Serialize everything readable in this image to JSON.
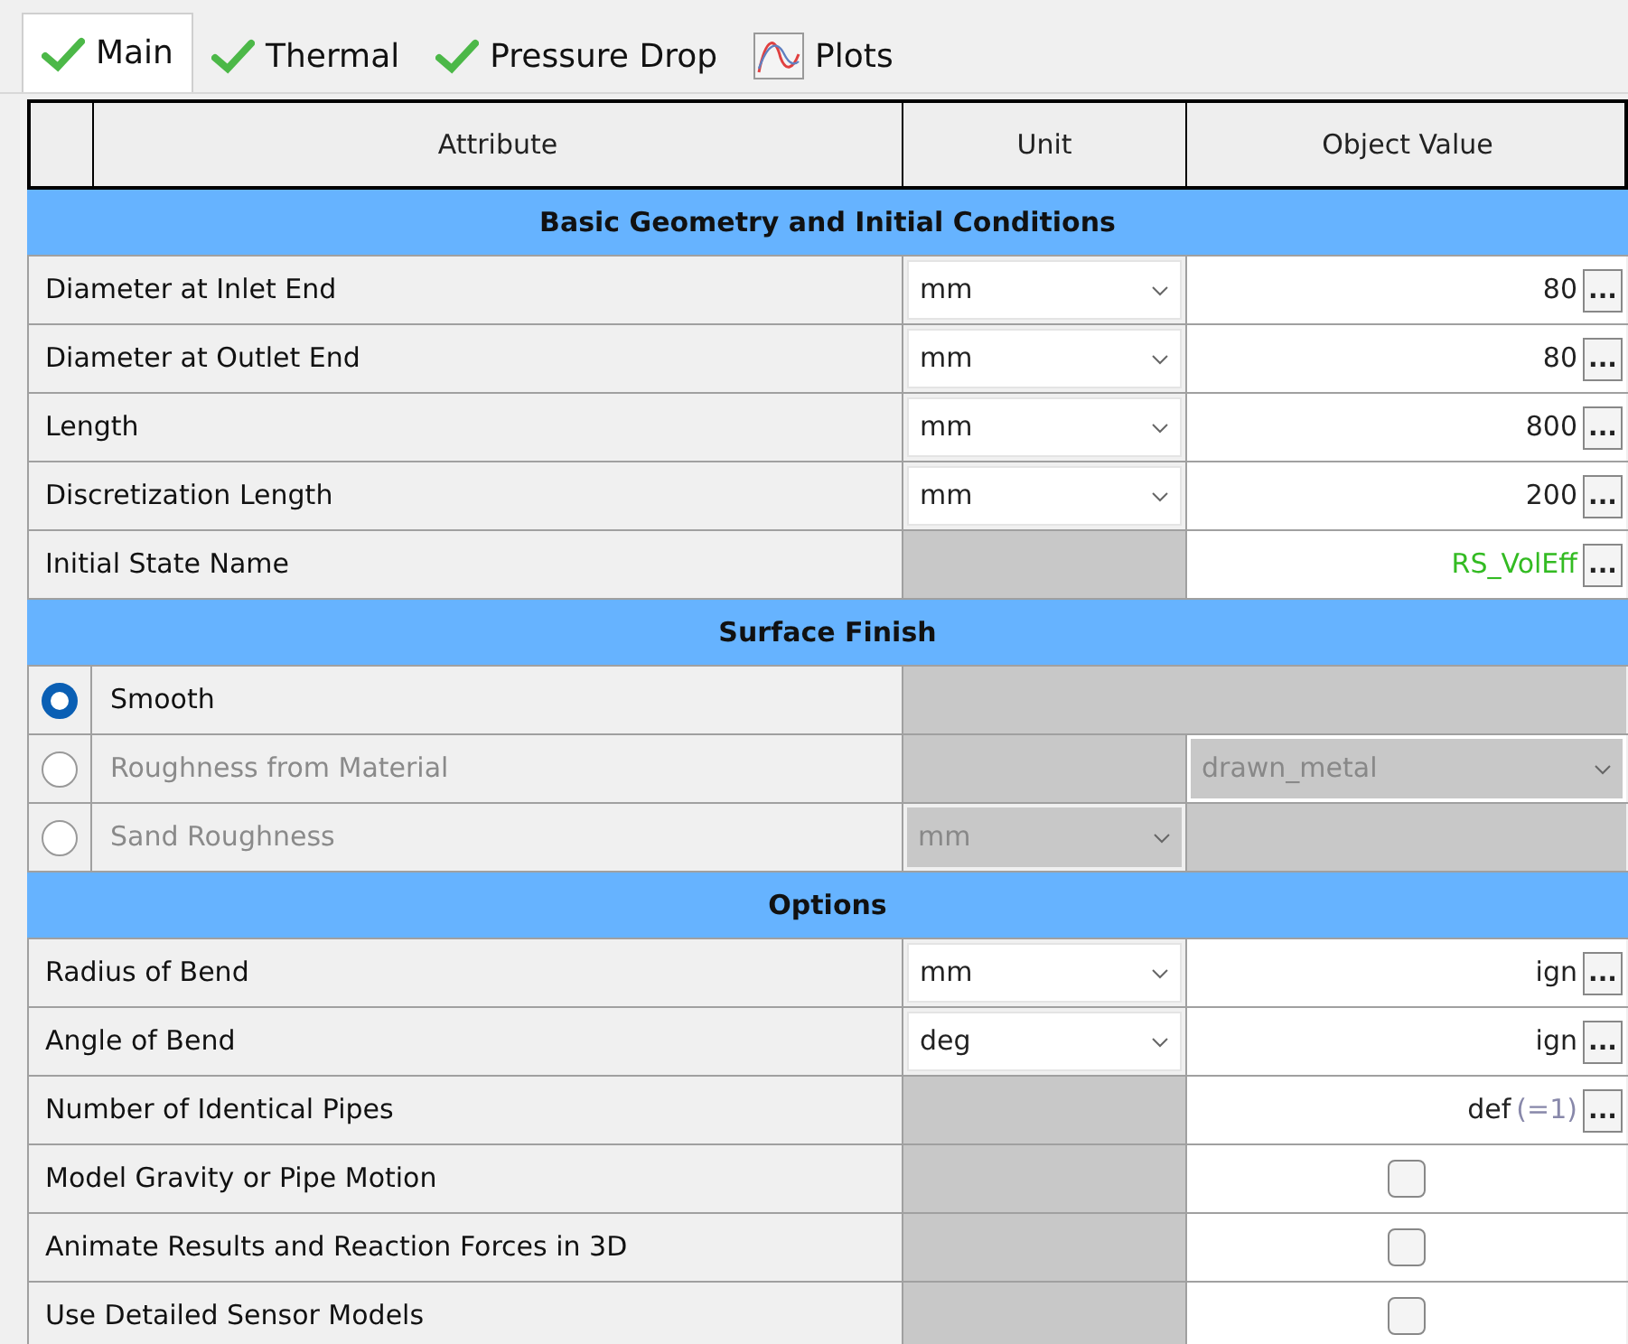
{
  "tabs": [
    {
      "label": "Main",
      "selected": true,
      "kind": "check"
    },
    {
      "label": "Thermal",
      "selected": false,
      "kind": "check"
    },
    {
      "label": "Pressure Drop",
      "selected": false,
      "kind": "check"
    },
    {
      "label": "Plots",
      "selected": false,
      "kind": "plot"
    }
  ],
  "table": {
    "columns": [
      "Attribute",
      "Unit",
      "Object Value"
    ],
    "sections": [
      {
        "title": "Basic Geometry and Initial Conditions",
        "rows": [
          {
            "kind": "value",
            "label": "Diameter at Inlet End",
            "unit": "mm",
            "value": "80",
            "button": "..."
          },
          {
            "kind": "value",
            "label": "Diameter at Outlet End",
            "unit": "mm",
            "value": "80",
            "button": "..."
          },
          {
            "kind": "value",
            "label": "Length",
            "unit": "mm",
            "value": "800",
            "button": "..."
          },
          {
            "kind": "value",
            "label": "Discretization Length",
            "unit": "mm",
            "value": "200",
            "button": "..."
          },
          {
            "kind": "value",
            "label": "Initial State Name",
            "value": "RS_VolEff",
            "reference": true,
            "button": "..."
          }
        ]
      },
      {
        "title": "Surface Finish",
        "rows": [
          {
            "kind": "radio",
            "label": "Smooth",
            "selected": true
          },
          {
            "kind": "radio",
            "label": "Roughness from Material",
            "selected": false,
            "disabled": true,
            "value_dropdown": "drawn_metal"
          },
          {
            "kind": "radio",
            "label": "Sand Roughness",
            "selected": false,
            "disabled": true,
            "unit": "mm"
          }
        ]
      },
      {
        "title": "Options",
        "rows": [
          {
            "kind": "value",
            "label": "Radius of Bend",
            "unit": "mm",
            "value": "ign",
            "button": "..."
          },
          {
            "kind": "value",
            "label": "Angle of Bend",
            "unit": "deg",
            "value": "ign",
            "button": "..."
          },
          {
            "kind": "value",
            "label": "Number of Identical Pipes",
            "value": "def",
            "hint": "(=1)",
            "button": "..."
          },
          {
            "kind": "checkbox",
            "label": "Model Gravity or Pipe Motion",
            "checked": false
          },
          {
            "kind": "checkbox",
            "label": "Animate Results and Reaction Forces in 3D",
            "checked": false
          },
          {
            "kind": "checkbox",
            "label": "Use Detailed Sensor Models",
            "checked": false
          }
        ]
      }
    ]
  }
}
